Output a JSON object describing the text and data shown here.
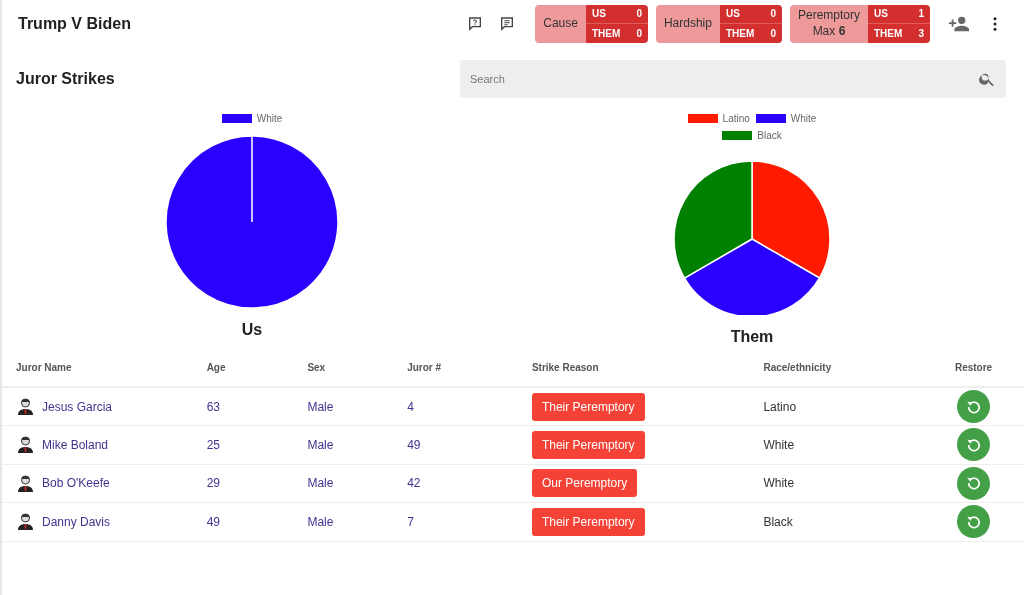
{
  "app_bar": {
    "title": "Trump V Biden",
    "counters": [
      {
        "label": "Cause",
        "us_label": "US",
        "us": "0",
        "them_label": "THEM",
        "them": "0"
      },
      {
        "label": "Hardship",
        "us_label": "US",
        "us": "0",
        "them_label": "THEM",
        "them": "0"
      },
      {
        "label": "Peremptory",
        "sublabel": "Max **6**",
        "us_label": "US",
        "us": "1",
        "them_label": "THEM",
        "them": "3"
      }
    ]
  },
  "section": {
    "title": "Juror Strikes",
    "search": {
      "placeholder": "Search"
    }
  },
  "charts": [
    {
      "chart_data": {
        "type": "pie",
        "title": "Us",
        "legend": "top",
        "categories": [
          "White"
        ],
        "colors": [
          "#2a00ff"
        ],
        "values": [
          100
        ]
      }
    },
    {
      "chart_data": {
        "type": "pie",
        "title": "Them",
        "legend": "top",
        "categories": [
          "Latino",
          "White",
          "Black"
        ],
        "colors": [
          "#ff1a00",
          "#2a00ff",
          "#008000"
        ],
        "values": [
          33.33,
          33.33,
          33.34
        ]
      }
    }
  ],
  "table": {
    "columns": [
      "Juror Name",
      "Age",
      "Sex",
      "Juror #",
      "Strike Reason",
      "Race/ethnicity",
      "Restore"
    ],
    "rows": [
      {
        "name": "Jesus Garcia",
        "age": "63",
        "sex": "Male",
        "number": "4",
        "reason": "Their Peremptory",
        "race": "Latino"
      },
      {
        "name": "Mike Boland",
        "age": "25",
        "sex": "Male",
        "number": "49",
        "reason": "Their Peremptory",
        "race": "White"
      },
      {
        "name": "Bob O'Keefe",
        "age": "29",
        "sex": "Male",
        "number": "42",
        "reason": "Our Peremptory",
        "race": "White"
      },
      {
        "name": "Danny Davis",
        "age": "49",
        "sex": "Male",
        "number": "7",
        "reason": "Their Peremptory",
        "race": "Black"
      }
    ]
  }
}
